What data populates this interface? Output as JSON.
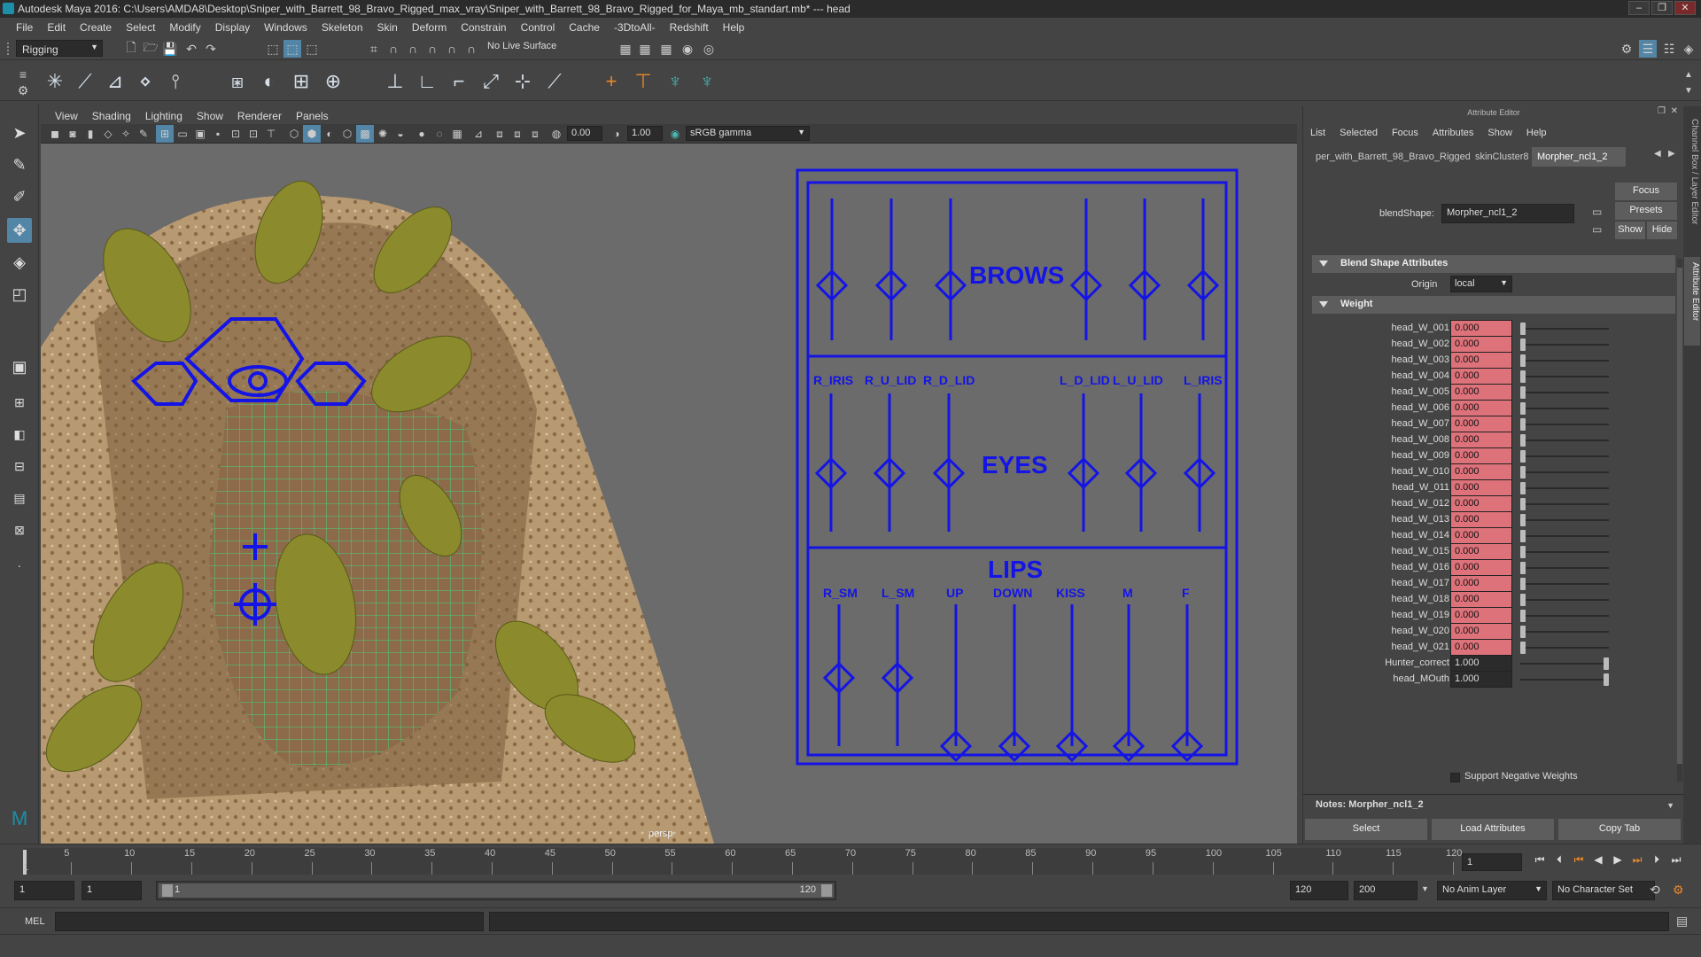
{
  "window": {
    "title": "Autodesk Maya 2016: C:\\Users\\AMDA8\\Desktop\\Sniper_with_Barrett_98_Bravo_Rigged_max_vray\\Sniper_with_Barrett_98_Bravo_Rigged_for_Maya_mb_standart.mb*  ---  head",
    "min": "–",
    "max": "❐",
    "close": "✕"
  },
  "menubar": [
    "File",
    "Edit",
    "Create",
    "Select",
    "Modify",
    "Display",
    "Windows",
    "Skeleton",
    "Skin",
    "Deform",
    "Constrain",
    "Control",
    "Cache",
    "-3DtoAll-",
    "Redshift",
    "Help"
  ],
  "statusline": {
    "menuset": "Rigging",
    "live_surface": "No Live Surface"
  },
  "viewport": {
    "menu": [
      "View",
      "Shading",
      "Lighting",
      "Show",
      "Renderer",
      "Panels"
    ],
    "near_value": "0.00",
    "far_value": "1.00",
    "color_space": "sRGB gamma",
    "camera_label": "persp"
  },
  "face_panel": {
    "brows": "BROWS",
    "eyes": "EYES",
    "lips": "LIPS",
    "eye_labels": [
      "R_IRIS",
      "R_U_LID",
      "R_D_LID",
      "L_D_LID",
      "L_U_LID",
      "L_IRIS"
    ],
    "lip_labels": [
      "R_SM",
      "L_SM",
      "UP",
      "DOWN",
      "KISS",
      "M",
      "F"
    ]
  },
  "attribute_editor": {
    "panel_title": "Attribute Editor",
    "menu": [
      "List",
      "Selected",
      "Focus",
      "Attributes",
      "Show",
      "Help"
    ],
    "tabs": [
      "per_with_Barrett_98_Bravo_Rigged",
      "skinCluster8",
      "Morpher_ncl1_2"
    ],
    "active_tab": "Morpher_ncl1_2",
    "node_label": "blendShape:",
    "node_name": "Morpher_ncl1_2",
    "focus_btn": "Focus",
    "presets_btn": "Presets",
    "show_btn": "Show",
    "hide_btn": "Hide",
    "section_blend": "Blend Shape Attributes",
    "origin_label": "Origin",
    "origin_value": "local",
    "section_weight": "Weight",
    "weights": [
      {
        "name": "head_W_001",
        "value": "0.000",
        "level": 0
      },
      {
        "name": "head_W_002",
        "value": "0.000",
        "level": 0
      },
      {
        "name": "head_W_003",
        "value": "0.000",
        "level": 0
      },
      {
        "name": "head_W_004",
        "value": "0.000",
        "level": 0
      },
      {
        "name": "head_W_005",
        "value": "0.000",
        "level": 0
      },
      {
        "name": "head_W_006",
        "value": "0.000",
        "level": 0
      },
      {
        "name": "head_W_007",
        "value": "0.000",
        "level": 0
      },
      {
        "name": "head_W_008",
        "value": "0.000",
        "level": 0
      },
      {
        "name": "head_W_009",
        "value": "0.000",
        "level": 0
      },
      {
        "name": "head_W_010",
        "value": "0.000",
        "level": 0
      },
      {
        "name": "head_W_011",
        "value": "0.000",
        "level": 0
      },
      {
        "name": "head_W_012",
        "value": "0.000",
        "level": 0
      },
      {
        "name": "head_W_013",
        "value": "0.000",
        "level": 0
      },
      {
        "name": "head_W_014",
        "value": "0.000",
        "level": 0
      },
      {
        "name": "head_W_015",
        "value": "0.000",
        "level": 0
      },
      {
        "name": "head_W_016",
        "value": "0.000",
        "level": 0
      },
      {
        "name": "head_W_017",
        "value": "0.000",
        "level": 0
      },
      {
        "name": "head_W_018",
        "value": "0.000",
        "level": 0
      },
      {
        "name": "head_W_019",
        "value": "0.000",
        "level": 0
      },
      {
        "name": "head_W_020",
        "value": "0.000",
        "level": 0
      },
      {
        "name": "head_W_021",
        "value": "0.000",
        "level": 0
      },
      {
        "name": "Hunter_correct",
        "value": "1.000",
        "level": 1
      },
      {
        "name": "head_MOuth",
        "value": "1.000",
        "level": 1
      }
    ],
    "support_negative": "Support Negative Weights",
    "notes_label": "Notes:  Morpher_ncl1_2",
    "btn_select": "Select",
    "btn_load": "Load Attributes",
    "btn_copy": "Copy Tab",
    "side_tab_channel": "Channel Box / Layer Editor",
    "side_tab_attr": "Attribute Editor"
  },
  "timeline": {
    "ticks": [
      "5",
      "10",
      "15",
      "20",
      "25",
      "30",
      "35",
      "40",
      "45",
      "50",
      "55",
      "60",
      "65",
      "70",
      "75",
      "80",
      "85",
      "90",
      "95",
      "100",
      "105",
      "110",
      "115",
      "120"
    ],
    "first_tick": "1",
    "current_frame": "1"
  },
  "range": {
    "start": "1",
    "playback_start": "1",
    "range_left": "1",
    "range_right": "120",
    "playback_end": "120",
    "end": "200",
    "anim_layer": "No Anim Layer",
    "character_set": "No Character Set"
  },
  "cmdline": {
    "label": "MEL"
  },
  "colors": {
    "rig_blue": "#1414e6",
    "wire_green": "#3ce68a",
    "keyed_field": "#dd727a",
    "accent": "#5285a6"
  }
}
